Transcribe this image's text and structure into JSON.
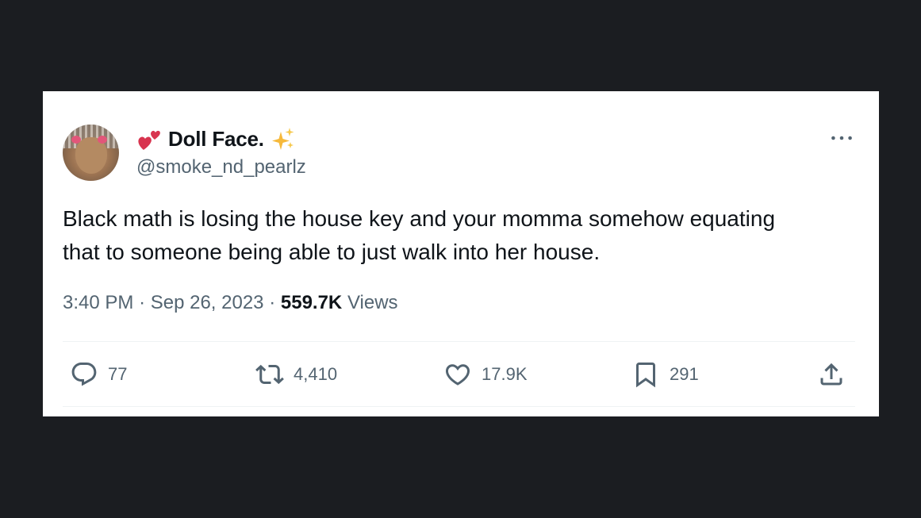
{
  "tweet": {
    "author": {
      "display_name": "Doll Face.",
      "handle": "@smoke_nd_pearlz",
      "name_prefix_icon": "two-hearts-emoji",
      "name_suffix_icon": "sparkles-emoji"
    },
    "text": "Black math is losing the house key and your momma somehow equating\nthat to someone being able to just walk into her house.",
    "time": "3:40 PM",
    "separator": "·",
    "date": "Sep 26, 2023",
    "views_count": "559.7K",
    "views_label": "Views",
    "actions": {
      "reply_count": "77",
      "retweet_count": "4,410",
      "like_count": "17.9K",
      "bookmark_count": "291"
    }
  },
  "colors": {
    "background": "#1b1d21",
    "card": "#ffffff",
    "primary_text": "#0f1419",
    "secondary_text": "#536471"
  }
}
